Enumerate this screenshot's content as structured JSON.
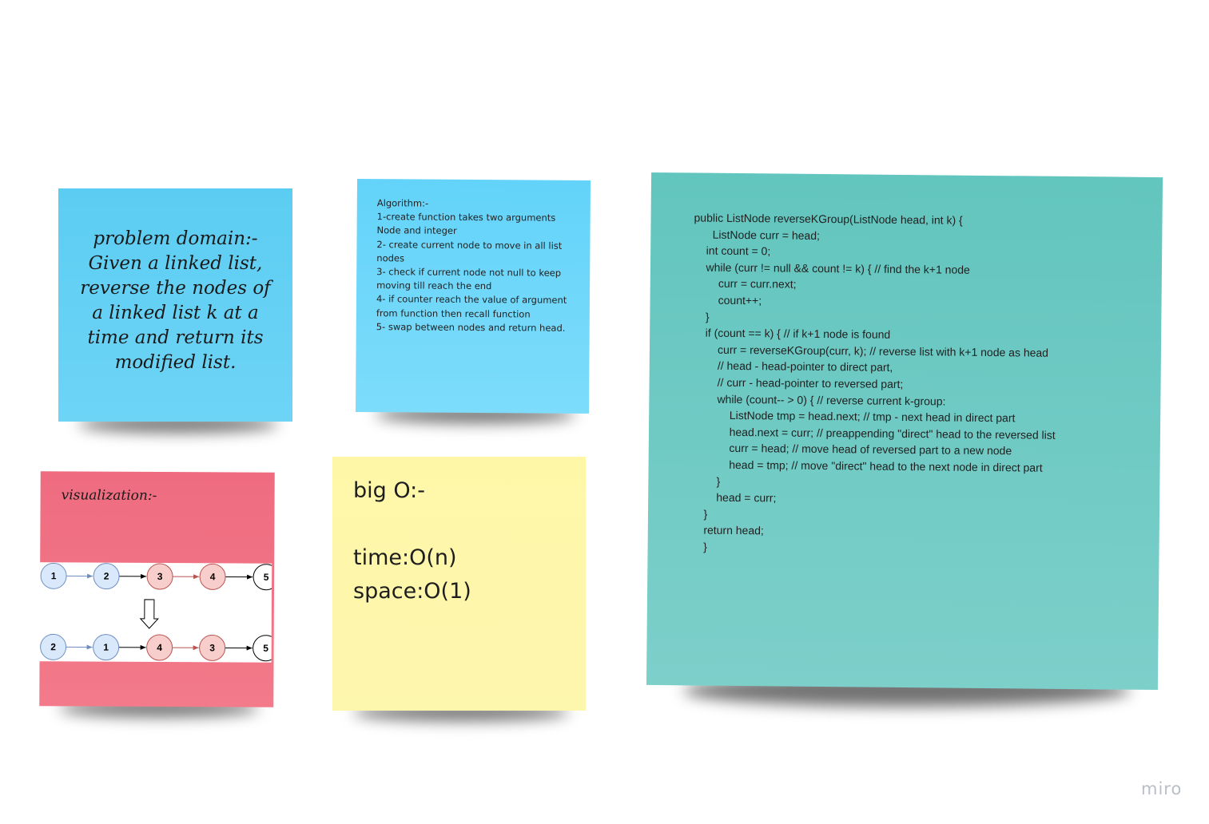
{
  "problem": {
    "text": "problem domain:-\nGiven a linked list,\nreverse the nodes of\na linked list k at a\ntime and return its\nmodified list."
  },
  "algorithm": {
    "text": "Algorithm:-\n1-create function takes two arguments\nNode and integer\n2- create current node to move in all list\nnodes\n3- check if current node not null to keep\nmoving till reach the end\n4- if counter reach the value of argument\nfrom function then recall function\n5- swap between nodes and return head."
  },
  "code": {
    "text": "public ListNode reverseKGroup(ListNode head, int k) {\n      ListNode curr = head;\n    int count = 0;\n    while (curr != null && count != k) { // find the k+1 node\n        curr = curr.next;\n        count++;\n    }\n    if (count == k) { // if k+1 node is found\n        curr = reverseKGroup(curr, k); // reverse list with k+1 node as head\n        // head - head-pointer to direct part,\n        // curr - head-pointer to reversed part;\n        while (count-- > 0) { // reverse current k-group:\n            ListNode tmp = head.next; // tmp - next head in direct part\n            head.next = curr; // preappending \"direct\" head to the reversed list\n            curr = head; // move head of reversed part to a new node\n            head = tmp; // move \"direct\" head to the next node in direct part\n        }\n        head = curr;\n    }\n    return head;\n    }"
  },
  "visualization": {
    "title": "visualization:-",
    "row1": [
      "1",
      "2",
      "3",
      "4",
      "5"
    ],
    "row2": [
      "2",
      "1",
      "4",
      "3",
      "5"
    ],
    "colors": {
      "blue_fill": "#dae8fc",
      "blue_stroke": "#6c8ebf",
      "red_fill": "#f8cecc",
      "red_stroke": "#b85450",
      "white_fill": "#ffffff",
      "white_stroke": "#000000"
    }
  },
  "bigo": {
    "title": "big O:-",
    "time": "time:O(n)",
    "space": "space:O(1)"
  },
  "brand": {
    "logo": "miro"
  }
}
